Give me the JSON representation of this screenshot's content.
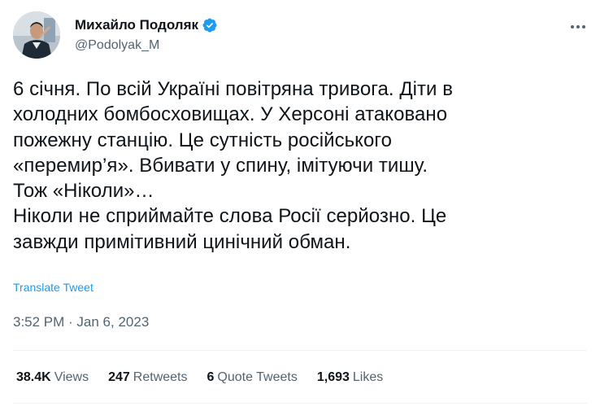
{
  "tweet": {
    "author": {
      "display_name": "Михайло Подоляк",
      "handle": "@Podolyak_M",
      "verified": true
    },
    "text": "6 січня. По всій Україні повітряна тривога. Діти в\nхолодних бомбосховищах. У Херсоні атаковано\nпожежну станцію. Це сутність російського\n«перемир’я». Вбивати у спину, імітуючи тишу.\nТож «Ніколи»…\nНіколи не сприймайте слова Росії серйозно. Це\nзавжди примітивний цинічний обман.",
    "translate_label": "Translate Tweet",
    "timestamp": "3:52 PM · Jan 6, 2023",
    "stats": {
      "views": {
        "count": "38.4K",
        "label": "Views"
      },
      "retweets": {
        "count": "247",
        "label": "Retweets"
      },
      "quote_tweets": {
        "count": "6",
        "label": "Quote Tweets"
      },
      "likes": {
        "count": "1,693",
        "label": "Likes"
      }
    }
  },
  "icons": {
    "verified": "verified-badge-icon",
    "more": "more-options-icon"
  },
  "colors": {
    "accent": "#1d9bf0",
    "secondary_text": "#536471",
    "primary_text": "#0f1419",
    "divider": "#eff3f4"
  }
}
